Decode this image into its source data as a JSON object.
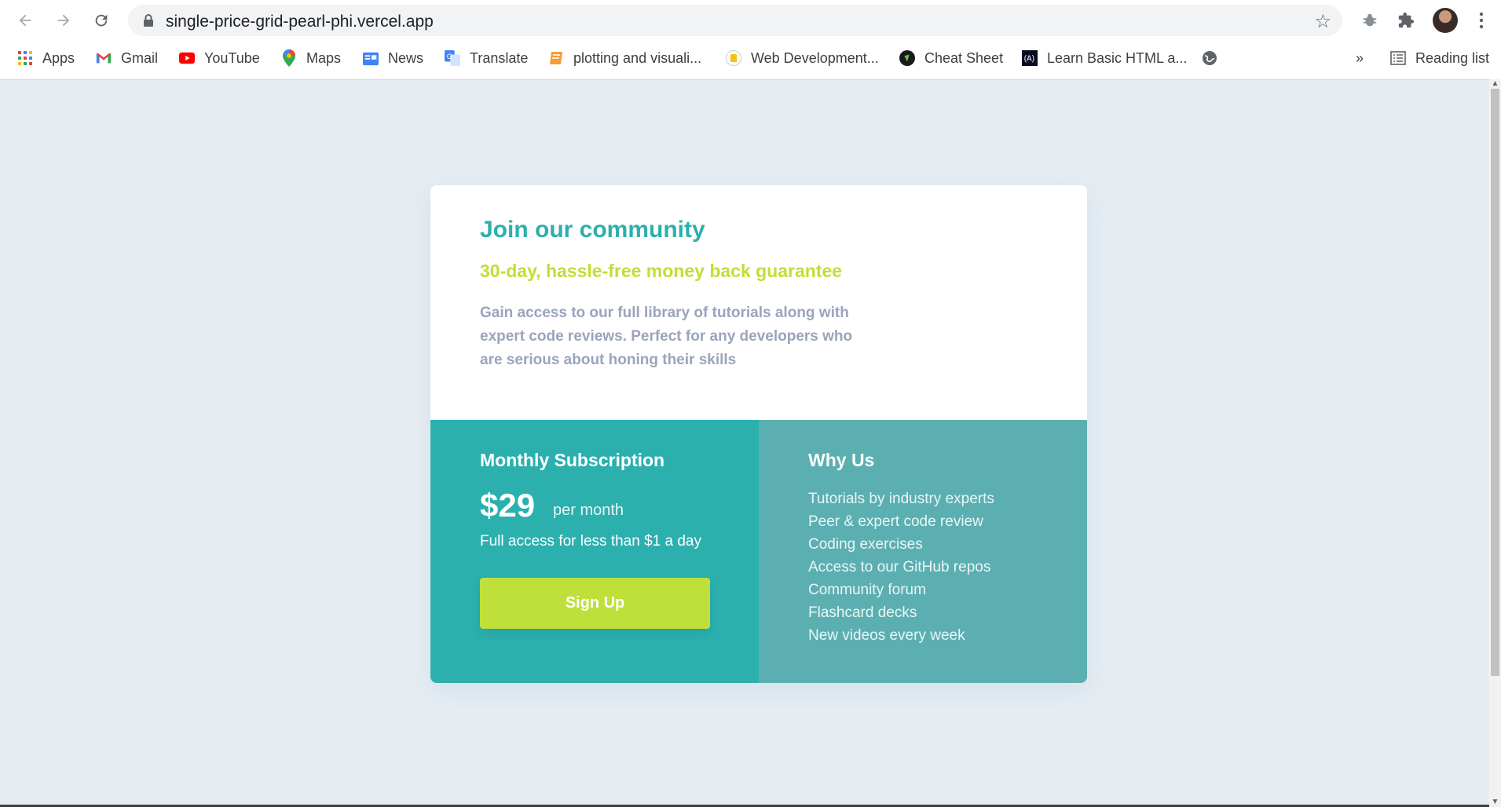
{
  "browser": {
    "url": "single-price-grid-pearl-phi.vercel.app",
    "bookmarks": [
      {
        "label": "Apps"
      },
      {
        "label": "Gmail"
      },
      {
        "label": "YouTube"
      },
      {
        "label": "Maps"
      },
      {
        "label": "News"
      },
      {
        "label": "Translate"
      },
      {
        "label": "plotting and visuali..."
      },
      {
        "label": "Web Development..."
      },
      {
        "label": "Cheat Sheet"
      },
      {
        "label": "Learn Basic HTML a..."
      }
    ],
    "overflow_label": "»",
    "reading_list": "Reading list",
    "colors": {
      "accent": "#2bb0ad",
      "lime": "#bfdf35"
    }
  },
  "card": {
    "title": "Join our community",
    "subtitle": "30-day, hassle-free money back guarantee",
    "description": "Gain access to our full library of tutorials along with expert code reviews. Perfect for any developers who are serious about honing their skills",
    "subscription": {
      "title": "Monthly Subscription",
      "price": "$29",
      "per": "per month",
      "access": "Full access for less than $1 a day",
      "button": "Sign Up"
    },
    "why": {
      "title": "Why Us",
      "items": [
        "Tutorials by industry experts",
        "Peer & expert code review",
        "Coding exercises",
        "Access to our GitHub repos",
        "Community forum",
        "Flashcard decks",
        "New videos every week"
      ]
    }
  }
}
